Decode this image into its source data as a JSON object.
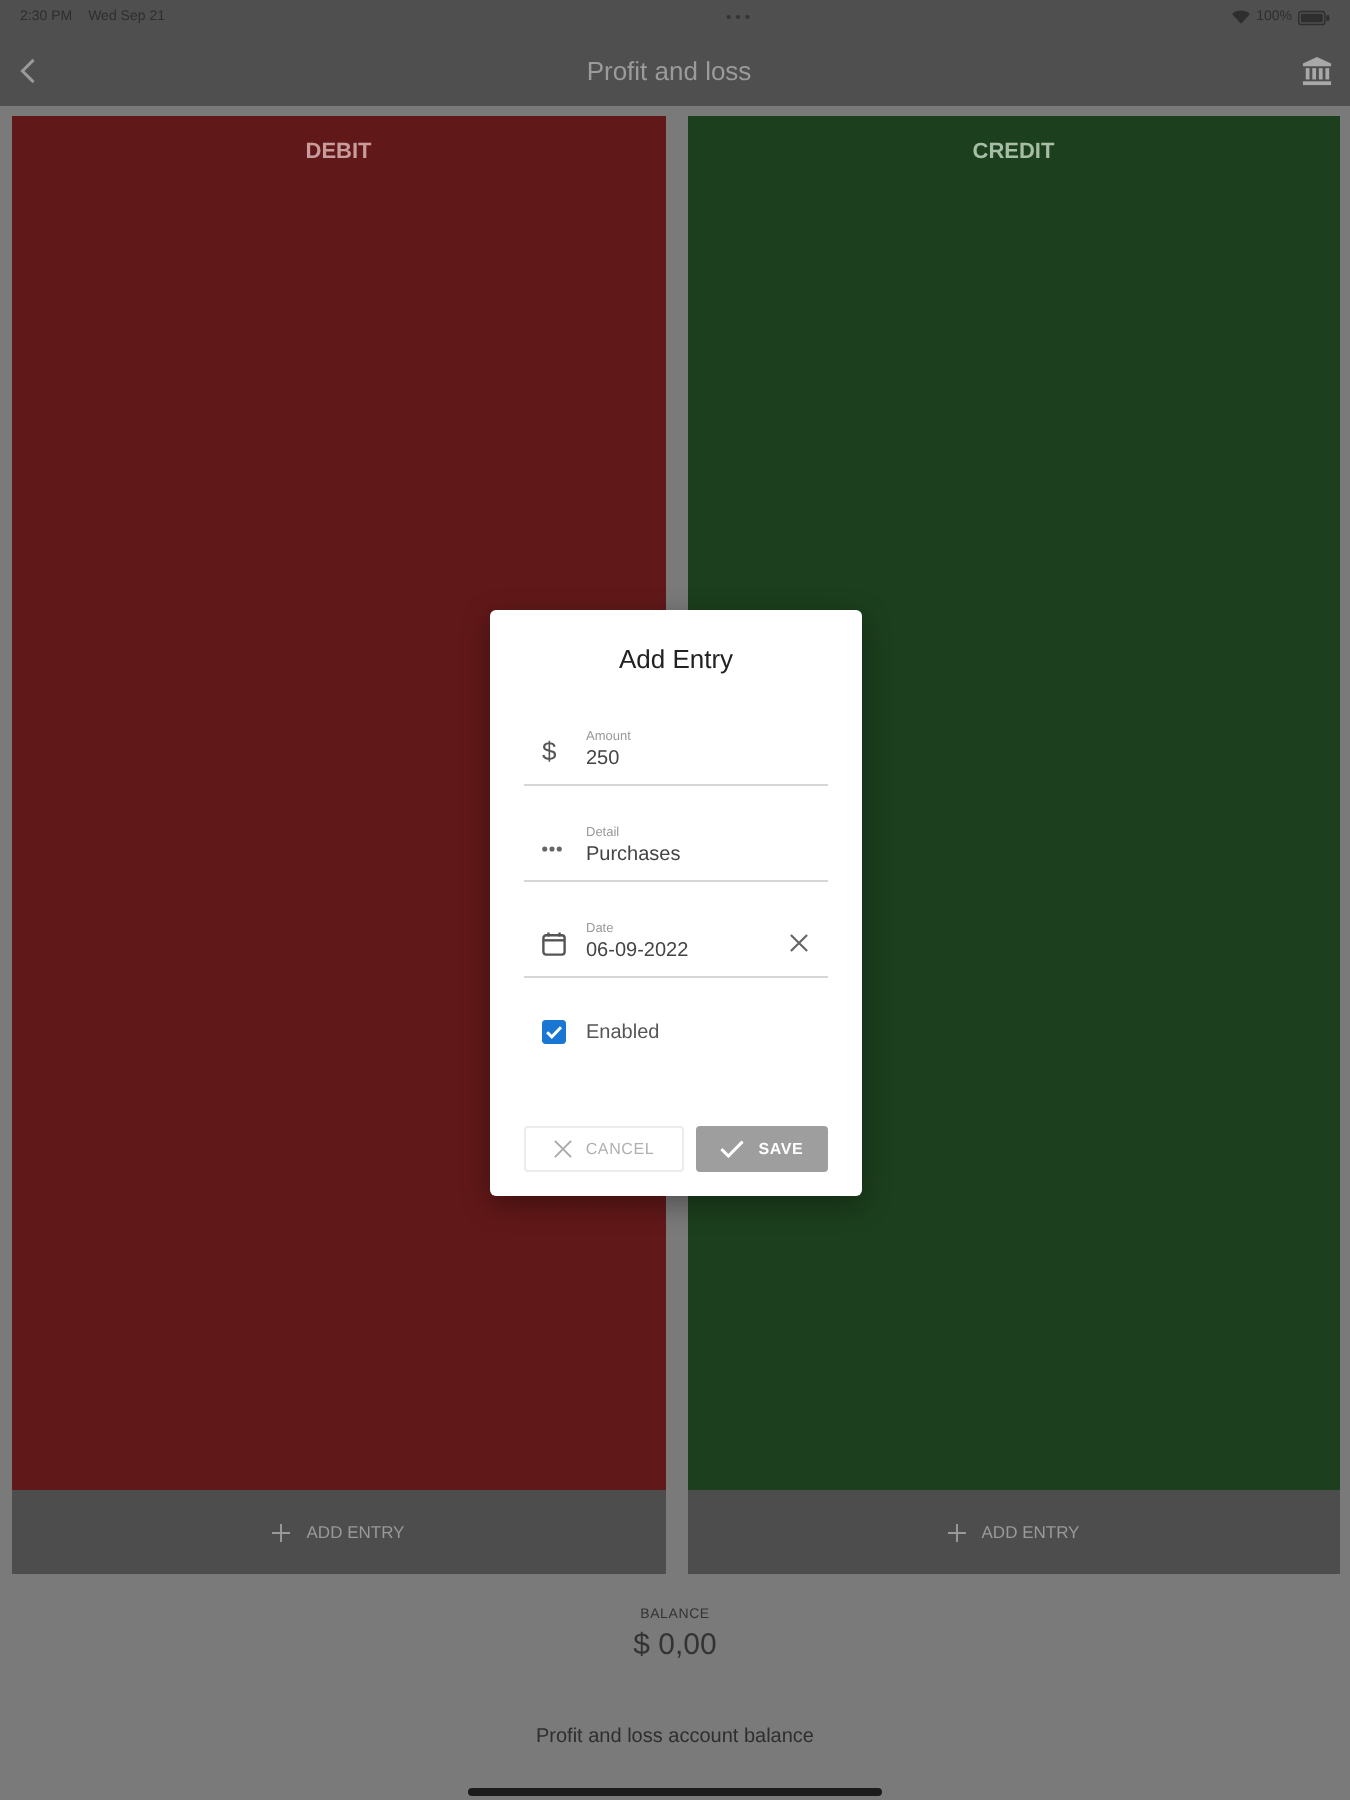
{
  "status_bar": {
    "time": "2:30 PM",
    "date": "Wed Sep 21",
    "battery": "100%"
  },
  "header": {
    "title": "Profit and loss"
  },
  "columns": [
    {
      "kind": "debit",
      "title": "DEBIT",
      "button": "ADD ENTRY"
    },
    {
      "kind": "credit",
      "title": "CREDIT",
      "button": "ADD ENTRY"
    }
  ],
  "balance": {
    "label": "BALANCE",
    "value": "$ 0,00"
  },
  "footer": {
    "text": "Profit and loss account balance"
  },
  "dialog": {
    "title": "Add Entry",
    "fields": [
      {
        "kind": "amount",
        "icon": "$",
        "label": "Amount",
        "value": "250",
        "clearable": false
      },
      {
        "kind": "detail",
        "label": "Detail",
        "value": "Purchases",
        "clearable": false
      },
      {
        "kind": "date",
        "label": "Date",
        "value": "06-09-2022",
        "clearable": true
      }
    ],
    "checkbox": {
      "label": "Enabled",
      "checked": true
    },
    "buttons": [
      {
        "kind": "cancel",
        "label": "CANCEL"
      },
      {
        "kind": "save",
        "label": "SAVE"
      }
    ]
  }
}
